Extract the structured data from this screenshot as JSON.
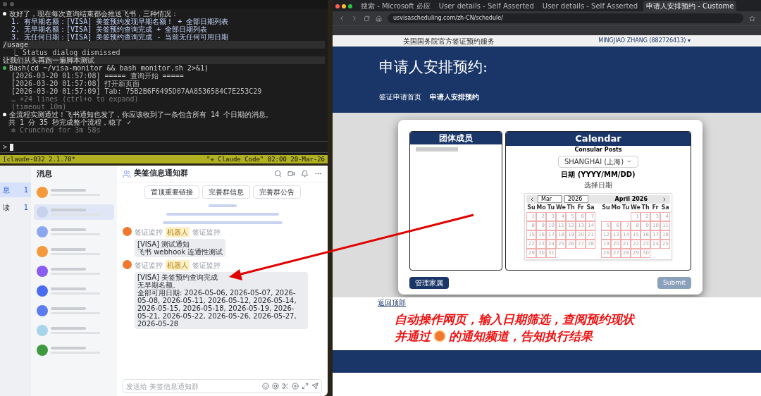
{
  "terminal": {
    "lines": [
      {
        "kind": "bullet",
        "text": "改好了，现在每次查询结束都会推送飞书，三种情况："
      },
      {
        "kind": "list",
        "text": "1. 有早期名额：[VISA] 美签预约发现早期名额！ + 全部日期列表"
      },
      {
        "kind": "list",
        "text": "2. 无早期名额：[VISA] 美签预约查询完成 + 全部日期列表"
      },
      {
        "kind": "list",
        "text": "3. 无任何日期：[VISA] 美签预约查询完成 - 当前无任何可用日期"
      },
      {
        "kind": "command",
        "text": "/usage"
      },
      {
        "kind": "output",
        "text": "⎿ Status dialog dismissed"
      },
      {
        "kind": "command",
        "text": "让我们从头再跑一遍脚本测试"
      },
      {
        "kind": "tool",
        "text": "Bash(cd ~/visa-monitor && bash monitor.sh 2>&1)"
      },
      {
        "kind": "output",
        "text": "[2026-03-20 01:57:08] ===== 查询开始 ====="
      },
      {
        "kind": "output",
        "text": "[2026-03-20 01:57:08] 打开新页面"
      },
      {
        "kind": "output",
        "text": "[2026-03-20 01:57:09] Tab: 75B2B6F6495D07AA8536584C7E253C29"
      },
      {
        "kind": "dim",
        "text": "… +24 lines (ctrl+o to expand)"
      },
      {
        "kind": "dim",
        "text": "(timeout 10m)"
      },
      {
        "kind": "bullet",
        "text": "全流程实测通过！飞书通知也发了，你应该收到了一条包含所有 14 个日期的消息。"
      },
      {
        "kind": "text",
        "text": "共 1 分 35 秒完成整个流程，稳了 ✓"
      },
      {
        "kind": "dim",
        "text": "✻ Crunched for 3m 58s"
      }
    ],
    "prompt": ">",
    "status_left": "[claude-032 2.1.78*",
    "status_right": "\"✳ Claude Code\" 02:00 20-Mar-26"
  },
  "chat": {
    "nav": [
      {
        "label": "息",
        "count": "1",
        "selected": true
      },
      {
        "label": "读",
        "count": "1",
        "selected": false
      }
    ],
    "list_title": "消息",
    "conversations": [
      {
        "selected": false
      },
      {
        "selected": true
      },
      {
        "selected": false
      },
      {
        "selected": false
      },
      {
        "selected": false
      },
      {
        "selected": false
      },
      {
        "selected": false
      },
      {
        "selected": false
      },
      {
        "selected": false
      }
    ],
    "group_title": "美签信息通知群",
    "header_buttons": [
      "置顶重要链接",
      "完善群信息",
      "完善群公告"
    ],
    "messages": [
      {
        "sender": "签证监控",
        "badge": "机器人",
        "source": "签证监控",
        "lines": [
          "[VISA] 测试通知",
          "飞书 webhook 连通性测试"
        ]
      },
      {
        "sender": "签证监控",
        "badge": "机器人",
        "source": "签证监控",
        "lines": [
          "[VISA] 美签预约查询完成",
          "无早期名额。",
          "全部可用日期: 2026-05-06, 2026-05-07, 2026-05-08, 2026-05-11, 2026-05-12, 2026-05-14, 2026-05-15, 2026-05-18, 2026-05-19, 2026-05-21, 2026-05-22, 2026-05-26, 2026-05-27, 2026-05-28"
        ]
      }
    ],
    "input_placeholder": "发送给 美签信息通知群"
  },
  "browser": {
    "tabs": [
      {
        "label": "搜索 - Microsoft 必应",
        "selected": false
      },
      {
        "label": "User details - Self Asserted",
        "selected": false
      },
      {
        "label": "User details - Self Asserted",
        "selected": false
      },
      {
        "label": "申请人安排预约 - Custome",
        "selected": true
      }
    ],
    "url": "usvisascheduling.com/zh-CN/schedule/",
    "site_label": "美国国务院官方签证预约服务",
    "user": "MINGJIAO ZHANG (882726413) ▾",
    "page_title": "申请人安排预约:",
    "breadcrumbs": [
      "签证申请首页",
      "申请人安排预约"
    ],
    "members_title": "团体成员",
    "calendar_title": "Calendar",
    "post_label": "Consular Posts",
    "post_value": "SHANGHAI (上海)",
    "date_label": "日期 (YYYY/MM/DD)",
    "date_hint": "选择日期",
    "month_select": "Mar",
    "year_select": "2026",
    "second_month": "April 2026",
    "months": [
      {
        "weekdays": [
          "Su",
          "Mo",
          "Tu",
          "We",
          "Th",
          "Fr",
          "Sa"
        ],
        "weeks": [
          [
            {
              "day": "1"
            },
            {
              "day": "2"
            },
            {
              "day": "3"
            },
            {
              "day": "4"
            },
            {
              "day": "5"
            },
            {
              "day": "6"
            },
            {
              "day": "7"
            }
          ],
          [
            {
              "day": "8"
            },
            {
              "day": "9"
            },
            {
              "day": "10"
            },
            {
              "day": "11"
            },
            {
              "day": "12"
            },
            {
              "day": "13"
            },
            {
              "day": "14"
            }
          ],
          [
            {
              "day": "15"
            },
            {
              "day": "16"
            },
            {
              "day": "17"
            },
            {
              "day": "18"
            },
            {
              "day": "19"
            },
            {
              "day": "20"
            },
            {
              "day": "21"
            }
          ],
          [
            {
              "day": "22"
            },
            {
              "day": "23"
            },
            {
              "day": "24"
            },
            {
              "day": "25"
            },
            {
              "day": "26"
            },
            {
              "day": "27"
            },
            {
              "day": "28"
            }
          ],
          [
            {
              "day": "29"
            },
            {
              "day": "30"
            },
            {
              "day": "31"
            },
            {
              "kind": "blank"
            },
            {
              "kind": "blank"
            },
            {
              "kind": "blank"
            },
            {
              "kind": "blank"
            }
          ]
        ]
      },
      {
        "weekdays": [
          "Su",
          "Mo",
          "Tu",
          "We",
          "Th",
          "Fr",
          "Sa"
        ],
        "weeks": [
          [
            {
              "kind": "blank"
            },
            {
              "kind": "blank"
            },
            {
              "kind": "blank"
            },
            {
              "day": "1"
            },
            {
              "day": "2"
            },
            {
              "day": "3"
            },
            {
              "day": "4"
            }
          ],
          [
            {
              "day": "5"
            },
            {
              "day": "6"
            },
            {
              "day": "7"
            },
            {
              "day": "8"
            },
            {
              "day": "9"
            },
            {
              "day": "10"
            },
            {
              "day": "11"
            }
          ],
          [
            {
              "day": "12"
            },
            {
              "day": "13"
            },
            {
              "day": "14"
            },
            {
              "day": "15"
            },
            {
              "day": "16"
            },
            {
              "day": "17"
            },
            {
              "day": "18"
            }
          ],
          [
            {
              "day": "19"
            },
            {
              "day": "20"
            },
            {
              "day": "21"
            },
            {
              "day": "22"
            },
            {
              "day": "23"
            },
            {
              "day": "24"
            },
            {
              "day": "25"
            }
          ],
          [
            {
              "day": "26"
            },
            {
              "day": "27"
            },
            {
              "day": "28"
            },
            {
              "day": "29"
            },
            {
              "day": "30"
            },
            {
              "kind": "blank"
            },
            {
              "kind": "blank"
            }
          ]
        ]
      }
    ],
    "manage_button": "管理家属",
    "submit_button": {
      "label": "Submit",
      "disabled": true
    },
    "back_to_top": "返回顶部"
  },
  "annotation": {
    "line1": "自动操作网页，输入日期筛选，查阅预约现状",
    "line2_before": "并通过",
    "line2_after": "的通知频道，告知执行结果"
  }
}
